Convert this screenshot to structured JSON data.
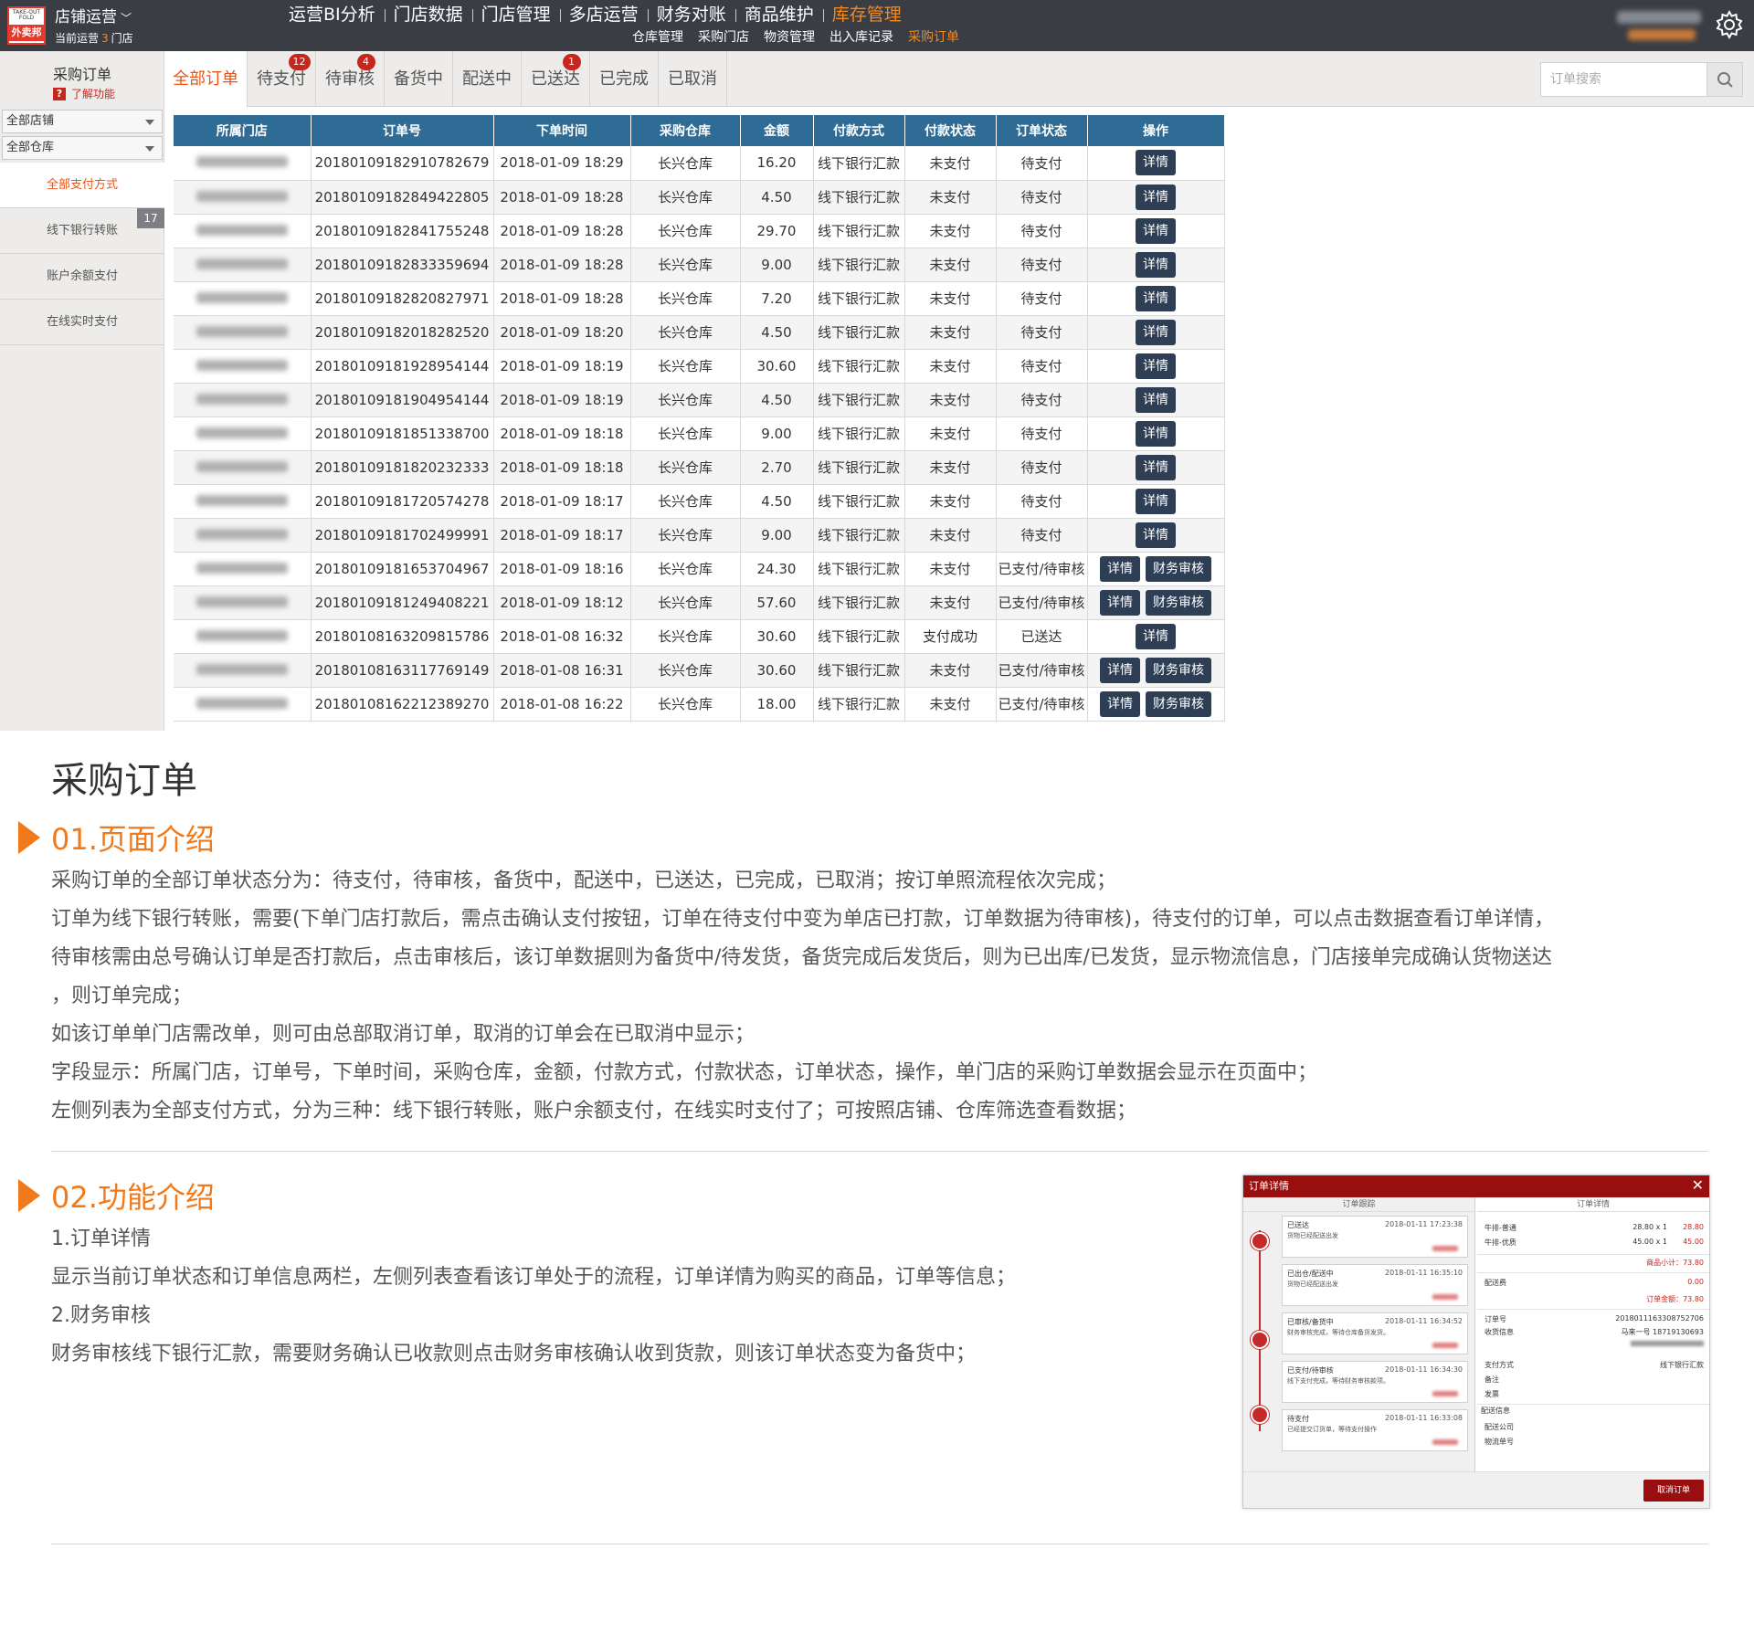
{
  "topbar": {
    "logo_text_small": "TAKE-OUT FOLD",
    "logo_text": "外卖邦",
    "store_switch": "店铺运营",
    "current_prefix": "当前运营",
    "current_count": "3",
    "current_suffix": "门店",
    "main_nav": [
      "运营BI分析",
      "门店数据",
      "门店管理",
      "多店运营",
      "财务对账",
      "商品维护",
      "库存管理"
    ],
    "main_nav_active": 6,
    "sub_nav": [
      "仓库管理",
      "采购门店",
      "物资管理",
      "出入库记录",
      "采购订单"
    ],
    "sub_nav_active": 4
  },
  "sidebar": {
    "title": "采购订单",
    "help_icon": "?",
    "help": "了解功能",
    "store_select": "全部店铺",
    "warehouse_select": "全部仓库",
    "pay_methods": [
      "全部支付方式",
      "线下银行转账",
      "账户余额支付",
      "在线实时支付"
    ],
    "bank_badge": "17"
  },
  "tabs": [
    {
      "label": "全部订单",
      "badge": ""
    },
    {
      "label": "待支付",
      "badge": "12"
    },
    {
      "label": "待审核",
      "badge": "4"
    },
    {
      "label": "备货中",
      "badge": ""
    },
    {
      "label": "配送中",
      "badge": ""
    },
    {
      "label": "已送达",
      "badge": "1"
    },
    {
      "label": "已完成",
      "badge": ""
    },
    {
      "label": "已取消",
      "badge": ""
    }
  ],
  "search": {
    "placeholder": "订单搜索"
  },
  "table": {
    "headers": [
      "所属门店",
      "订单号",
      "下单时间",
      "采购仓库",
      "金额",
      "付款方式",
      "付款状态",
      "订单状态",
      "操作"
    ],
    "detail_label": "详情",
    "audit_label": "财务审核",
    "rows": [
      {
        "no": "2018010918291078267​9",
        "time": "2018-01-09 18:29",
        "wh": "长兴仓库",
        "amt": "16.20",
        "pay": "线下银行汇款",
        "pstat": "未支付",
        "ostat": "待支付",
        "audit": false
      },
      {
        "no": "20180109182849422805",
        "time": "2018-01-09 18:28",
        "wh": "长兴仓库",
        "amt": "4.50",
        "pay": "线下银行汇款",
        "pstat": "未支付",
        "ostat": "待支付",
        "audit": false
      },
      {
        "no": "20180109182841755248",
        "time": "2018-01-09 18:28",
        "wh": "长兴仓库",
        "amt": "29.70",
        "pay": "线下银行汇款",
        "pstat": "未支付",
        "ostat": "待支付",
        "audit": false
      },
      {
        "no": "20180109182833359694",
        "time": "2018-01-09 18:28",
        "wh": "长兴仓库",
        "amt": "9.00",
        "pay": "线下银行汇款",
        "pstat": "未支付",
        "ostat": "待支付",
        "audit": false
      },
      {
        "no": "20180109182820827971",
        "time": "2018-01-09 18:28",
        "wh": "长兴仓库",
        "amt": "7.20",
        "pay": "线下银行汇款",
        "pstat": "未支付",
        "ostat": "待支付",
        "audit": false
      },
      {
        "no": "20180109182018282520",
        "time": "2018-01-09 18:20",
        "wh": "长兴仓库",
        "amt": "4.50",
        "pay": "线下银行汇款",
        "pstat": "未支付",
        "ostat": "待支付",
        "audit": false
      },
      {
        "no": "20180109181928954144",
        "time": "2018-01-09 18:19",
        "wh": "长兴仓库",
        "amt": "30.60",
        "pay": "线下银行汇款",
        "pstat": "未支付",
        "ostat": "待支付",
        "audit": false
      },
      {
        "no": "20180109181904954144",
        "time": "2018-01-09 18:19",
        "wh": "长兴仓库",
        "amt": "4.50",
        "pay": "线下银行汇款",
        "pstat": "未支付",
        "ostat": "待支付",
        "audit": false
      },
      {
        "no": "20180109181851338700",
        "time": "2018-01-09 18:18",
        "wh": "长兴仓库",
        "amt": "9.00",
        "pay": "线下银行汇款",
        "pstat": "未支付",
        "ostat": "待支付",
        "audit": false
      },
      {
        "no": "20180109181820232333",
        "time": "2018-01-09 18:18",
        "wh": "长兴仓库",
        "amt": "2.70",
        "pay": "线下银行汇款",
        "pstat": "未支付",
        "ostat": "待支付",
        "audit": false
      },
      {
        "no": "20180109181720574278",
        "time": "2018-01-09 18:17",
        "wh": "长兴仓库",
        "amt": "4.50",
        "pay": "线下银行汇款",
        "pstat": "未支付",
        "ostat": "待支付",
        "audit": false
      },
      {
        "no": "20180109181702499991",
        "time": "2018-01-09 18:17",
        "wh": "长兴仓库",
        "amt": "9.00",
        "pay": "线下银行汇款",
        "pstat": "未支付",
        "ostat": "待支付",
        "audit": false
      },
      {
        "no": "20180109181653704967",
        "time": "2018-01-09 18:16",
        "wh": "长兴仓库",
        "amt": "24.30",
        "pay": "线下银行汇款",
        "pstat": "未支付",
        "ostat": "已支付/待审核",
        "audit": true
      },
      {
        "no": "20180109181249408221",
        "time": "2018-01-09 18:12",
        "wh": "长兴仓库",
        "amt": "57.60",
        "pay": "线下银行汇款",
        "pstat": "未支付",
        "ostat": "已支付/待审核",
        "audit": true
      },
      {
        "no": "20180108163209815786",
        "time": "2018-01-08 16:32",
        "wh": "长兴仓库",
        "amt": "30.60",
        "pay": "线下银行汇款",
        "pstat": "支付成功",
        "ostat": "已送达",
        "audit": false
      },
      {
        "no": "20180108163117769149",
        "time": "2018-01-08 16:31",
        "wh": "长兴仓库",
        "amt": "30.60",
        "pay": "线下银行汇款",
        "pstat": "未支付",
        "ostat": "已支付/待审核",
        "audit": true
      },
      {
        "no": "20180108162212389270",
        "time": "2018-01-08 16:22",
        "wh": "长兴仓库",
        "amt": "18.00",
        "pay": "线下银行汇款",
        "pstat": "未支付",
        "ostat": "已支付/待审核",
        "audit": true
      }
    ]
  },
  "doc": {
    "title": "采购订单",
    "sec1_title": "01.页面介绍",
    "sec1_lines": [
      "采购订单的全部订单状态分为：待支付，待审核，备货中，配送中，已送达，已完成，已取消；按订单照流程依次完成；",
      "订单为线下银行转账，需要(下单门店打款后，需点击确认支付按钮，订单在待支付中变为单店已打款，订单数据为待审核)，待支付的订单，可以点击数据查看订单详情，",
      "待审核需由总号确认订单是否打款后，点击审核后，该订单数据则为备货中/待发货，备货完成后发货后，则为已出库/已发货，显示物流信息，门店接单完成确认货物送达",
      "，则订单完成；",
      "如该订单单门店需改单，则可由总部取消订单，取消的订单会在已取消中显示；",
      "字段显示：所属门店，订单号，下单时间，采购仓库，金额，付款方式，付款状态，订单状态，操作，单门店的采购订单数据会显示在页面中；",
      "左侧列表为全部支付方式，分为三种：线下银行转账，账户余额支付，在线实时支付了；可按照店铺、仓库筛选查看数据；"
    ],
    "sec2_title": "02.功能介绍",
    "sec2_lines": [
      "1.订单详情",
      "显示当前订单状态和订单信息两栏，左侧列表查看该订单处于的流程，订单详情为购买的商品，订单等信息；",
      "2.财务审核",
      "财务审核线下银行汇款，需要财务确认已收款则点击财务审核确认收到货款，则该订单状态变为备货中；"
    ]
  },
  "modal": {
    "title": "订单详情",
    "close": "✕",
    "left_header": "订单跟踪",
    "right_header": "订单详情",
    "timeline": [
      {
        "title": "已送达",
        "time": "2018-01-11 17:23:38",
        "desc": "货物已经配送出发"
      },
      {
        "title": "已出仓/配送中",
        "time": "2018-01-11 16:35:10",
        "desc": "货物已经配送出发"
      },
      {
        "title": "已审核/备货中",
        "time": "2018-01-11 16:34:52",
        "desc": "财务审核完成，等待仓库备货发货。"
      },
      {
        "title": "已支付/待审核",
        "time": "2018-01-11 16:34:30",
        "desc": "线下支付完成，等待财务审核款项。"
      },
      {
        "title": "待支付",
        "time": "2018-01-11 16:33:08",
        "desc": "已经提交订货单，等待支付操作"
      }
    ],
    "items": [
      {
        "name": "牛排-普通",
        "qty": "28.80 x 1",
        "price": "28.80"
      },
      {
        "name": "牛排-优质",
        "qty": "45.00 x 1",
        "price": "45.00"
      }
    ],
    "subtotal": "商品小计：73.80",
    "delivery_label": "配送费",
    "delivery_value": "0.00",
    "total": "订单金额：73.80",
    "order_no_label": "订单号",
    "order_no": "2018011163308752706",
    "receiver_label": "收货信息",
    "receiver": "马来一号 18719130693",
    "pay_label": "支付方式",
    "pay_value": "线下银行汇款",
    "remark_label": "备注",
    "invoice_label": "发票",
    "delivery_info": "配送信息",
    "company_label": "配送公司",
    "tracking_label": "物流单号",
    "cancel": "取消订单"
  }
}
